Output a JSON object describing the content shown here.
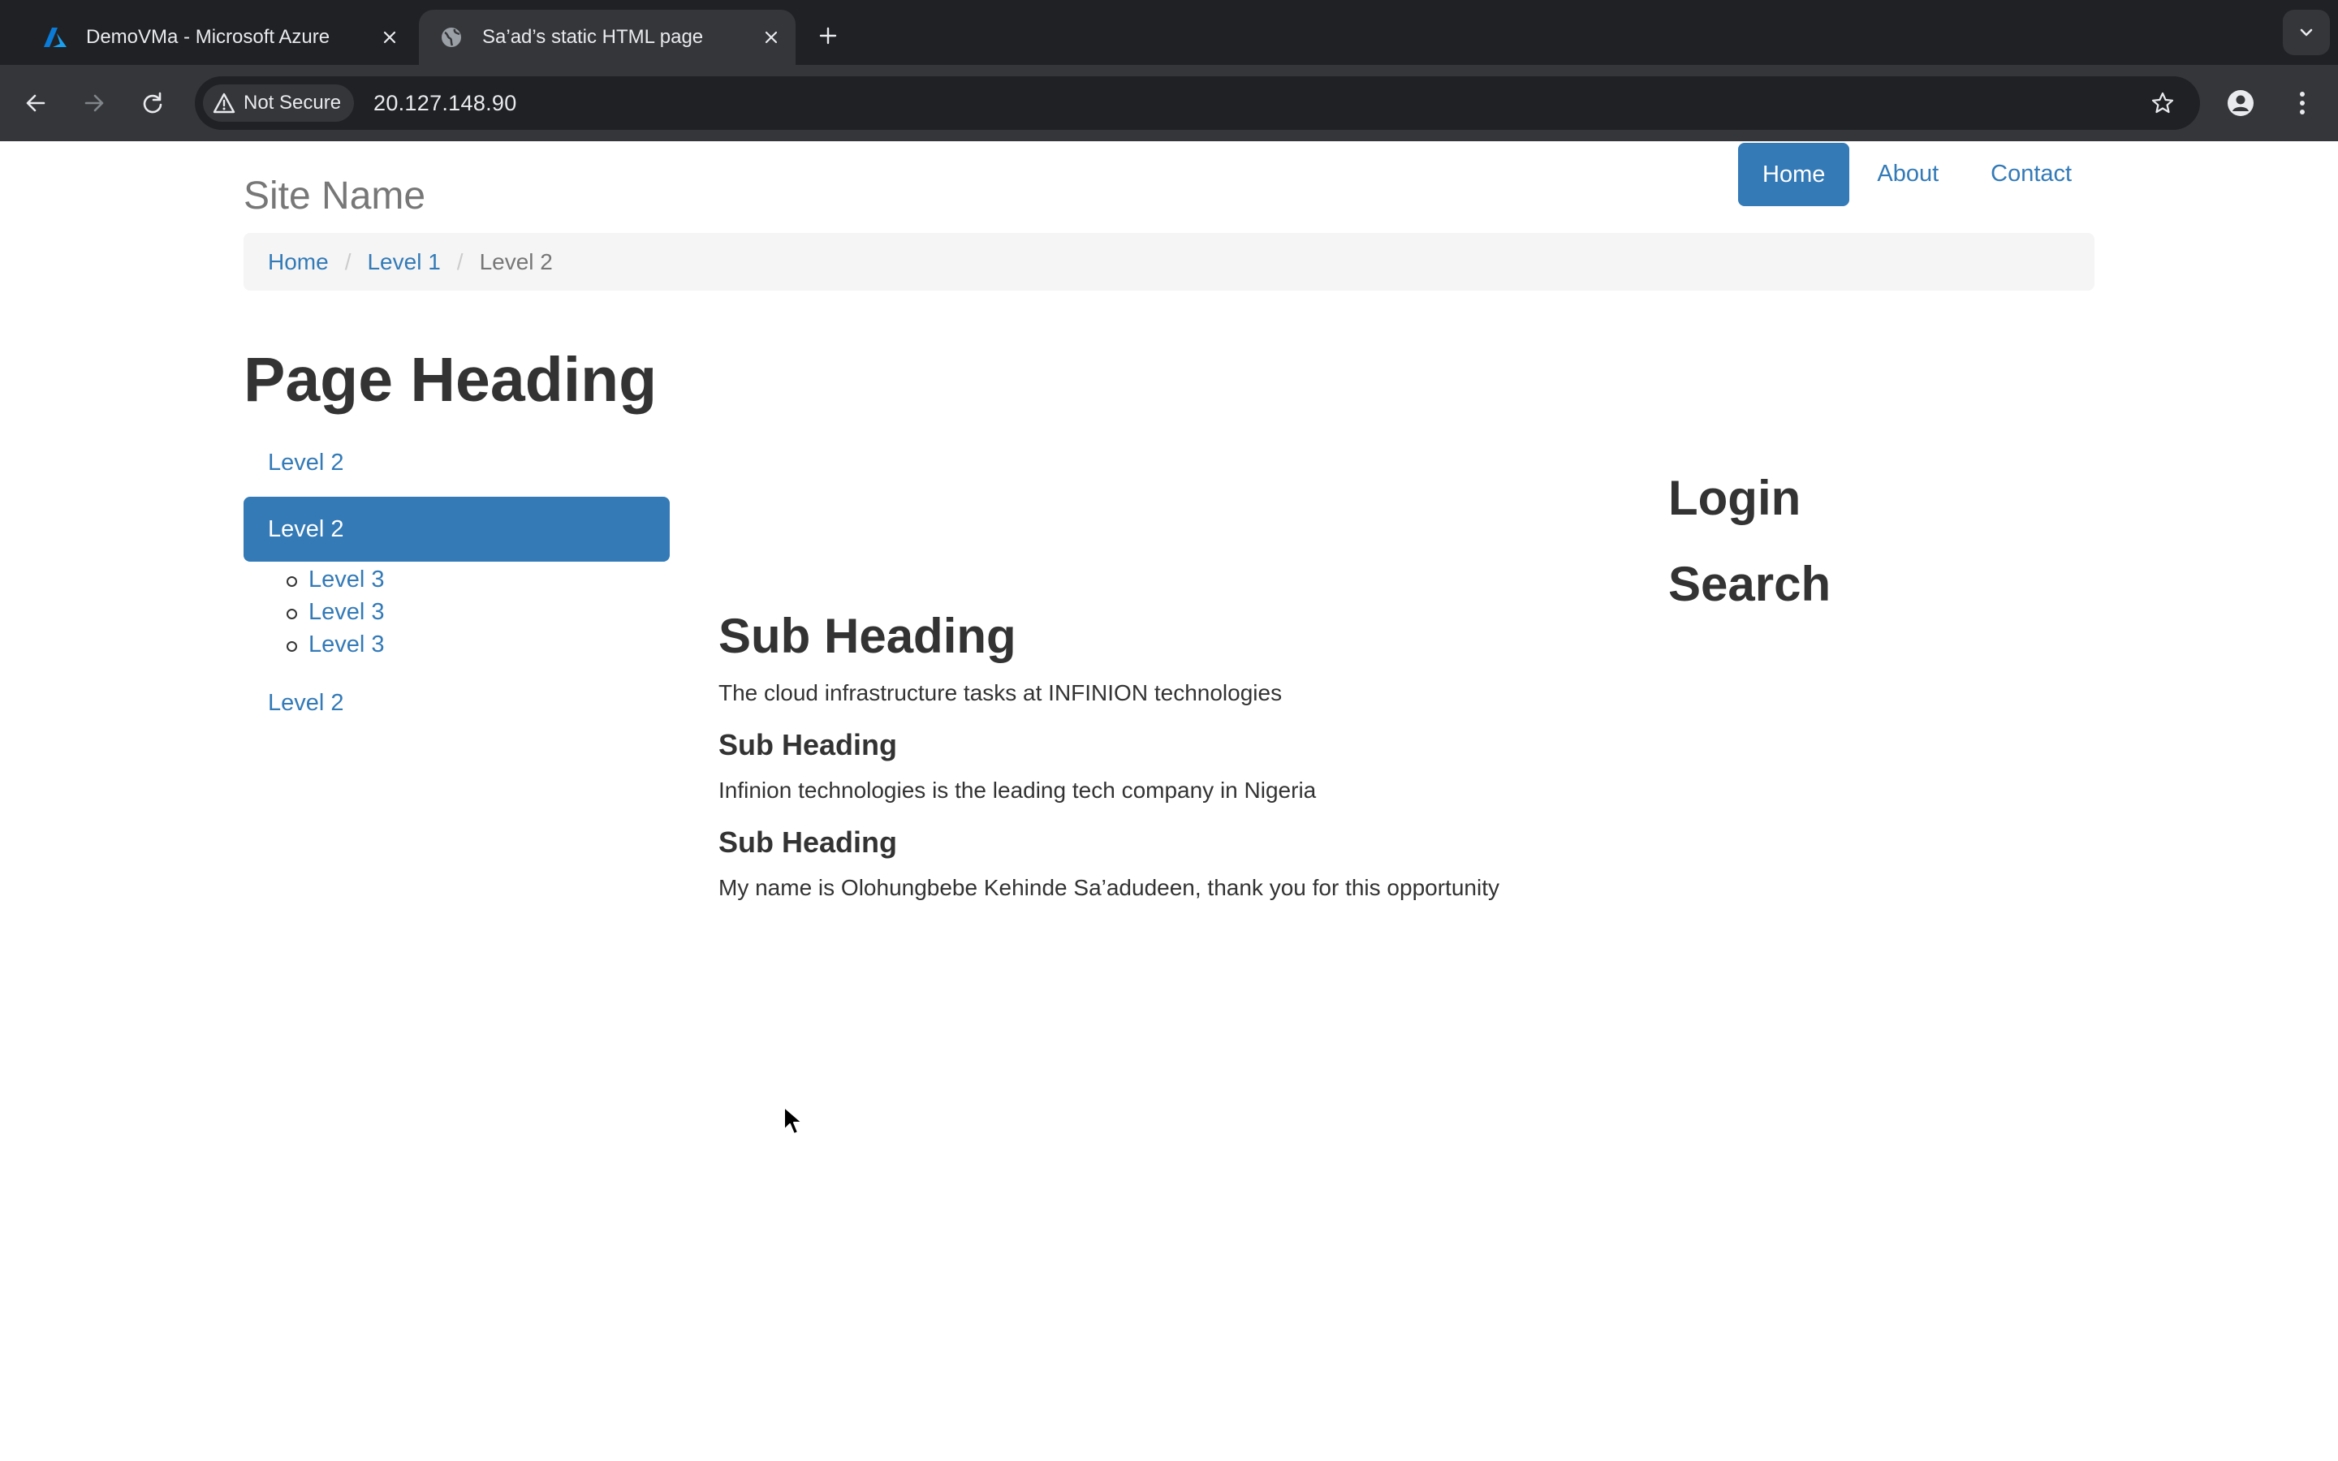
{
  "browser": {
    "tabs": [
      {
        "title": "DemoVMa - Microsoft Azure",
        "active": false,
        "favicon": "azure-icon"
      },
      {
        "title": "Sa’ad’s static HTML page",
        "active": true,
        "favicon": "globe-icon"
      }
    ],
    "security_label": "Not Secure",
    "url": "20.127.148.90"
  },
  "site": {
    "name": "Site Name",
    "nav": [
      {
        "label": "Home",
        "active": true
      },
      {
        "label": "About",
        "active": false
      },
      {
        "label": "Contact",
        "active": false
      }
    ]
  },
  "breadcrumb": {
    "items": [
      "Home",
      "Level 1"
    ],
    "current": "Level 2"
  },
  "page": {
    "heading": "Page Heading"
  },
  "sidenav": {
    "items": [
      {
        "label": "Level 2",
        "active": false
      },
      {
        "label": "Level 2",
        "active": true,
        "children": [
          "Level 3",
          "Level 3",
          "Level 3"
        ]
      },
      {
        "label": "Level 2",
        "active": false
      }
    ]
  },
  "main": {
    "heading": "Sub Heading",
    "intro": "The cloud infrastructure tasks at INFINION technologies",
    "sections": [
      {
        "heading": "Sub Heading",
        "text": "Infinion technologies is the leading tech company in Nigeria"
      },
      {
        "heading": "Sub Heading",
        "text": "My name is Olohungbebe Kehinde Sa’adudeen, thank you for this opportunity"
      }
    ]
  },
  "right": {
    "login_heading": "Login",
    "search_heading": "Search"
  },
  "colors": {
    "chrome_dark": "#202124",
    "chrome_toolbar": "#35363a",
    "link": "#337ab7",
    "text": "#333333",
    "muted": "#777777",
    "breadcrumb_bg": "#f5f5f5"
  }
}
